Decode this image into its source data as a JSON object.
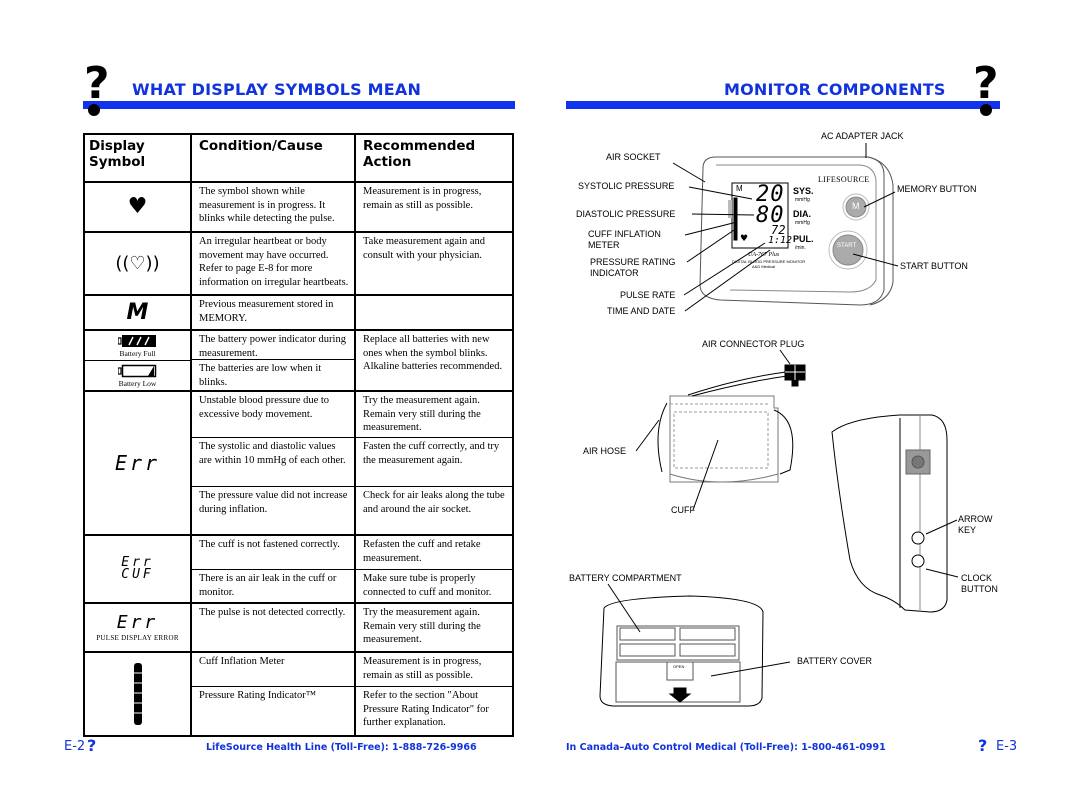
{
  "left_page": {
    "title": "WHAT DISPLAY SYMBOLS MEAN",
    "page_number": "E-2",
    "footer_text": "LifeSource Health Line (Toll-Free): 1-888-726-9966",
    "table": {
      "headers": [
        "Display Symbol",
        "Condition/Cause",
        "Recommended Action"
      ],
      "header_line1": [
        "Display",
        "Condition/Cause",
        "Recommended"
      ],
      "header_line2": [
        "Symbol",
        "",
        "Action"
      ],
      "groups": [
        {
          "symbol_icon": "heart-icon",
          "rows": [
            {
              "condition": "The symbol shown while measurement is in progress. It blinks while detecting the pulse.",
              "action": "Measurement is in progress, remain as still as possible."
            }
          ]
        },
        {
          "symbol_icon": "irregular-heartbeat-icon",
          "rows": [
            {
              "condition": "An irregular heartbeat or body movement may have occurred. Refer to page E-8 for more information on irregular heartbeats.",
              "action": "Take measurement again and consult with your physician."
            }
          ]
        },
        {
          "symbol_text": "M",
          "symbol_icon": "memory-icon",
          "rows": [
            {
              "condition": "Previous measurement stored in MEMORY.",
              "action": ""
            }
          ]
        },
        {
          "symbol_icon": "battery-icon",
          "symbol_labels": [
            "Battery Full",
            "Battery Low"
          ],
          "rows": [
            {
              "condition": "The battery power indicator during measurement.",
              "action": "Replace all batteries with new ones when the symbol blinks. Alkaline batteries recommended."
            },
            {
              "condition": "The batteries are low when it blinks.",
              "action": ""
            }
          ]
        },
        {
          "symbol_text": "Err",
          "rows": [
            {
              "condition": "Unstable blood pressure due to excessive body movement.",
              "action": "Try the measurement again. Remain very still during the measurement."
            },
            {
              "condition": "The systolic and diastolic values are within 10 mmHg of each other.",
              "action": "Fasten the cuff correctly, and try the measurement again."
            },
            {
              "condition": "The pressure value did not increase during inflation.",
              "action": "Check for air leaks along the tube and around the air socket."
            }
          ]
        },
        {
          "symbol_text": "Err",
          "symbol_text2": "CUF",
          "rows": [
            {
              "condition": "The cuff is not fastened correctly.",
              "action": "Refasten the cuff and retake measurement."
            },
            {
              "condition": "There is an air leak in the cuff or monitor.",
              "action": "Make sure tube is properly connected to cuff and monitor."
            }
          ]
        },
        {
          "symbol_text": "Err",
          "symbol_caption": "PULSE DISPLAY ERROR",
          "rows": [
            {
              "condition": "The pulse is not detected correctly.",
              "action": "Try the measurement again. Remain very still during the measurement."
            }
          ]
        },
        {
          "symbol_icon": "bar-meter-icon",
          "rows": [
            {
              "condition": "Cuff Inflation Meter",
              "action": "Measurement is in progress, remain as still as possible."
            },
            {
              "condition": "Pressure Rating Indicator™",
              "action": "Refer to the section \"About Pressure Rating Indicator\" for further explanation."
            }
          ]
        }
      ]
    }
  },
  "right_page": {
    "title": "MONITOR COMPONENTS",
    "page_number": "E-3",
    "footer_text": "In Canada–Auto Control Medical (Toll-Free): 1-800-461-0991",
    "labels": {
      "ac_adapter_jack": "AC ADAPTER JACK",
      "air_socket": "AIR SOCKET",
      "systolic_pressure": "SYSTOLIC PRESSURE",
      "diastolic_pressure": "DIASTOLIC PRESSURE",
      "cuff_inflation_meter_1": "CUFF INFLATION",
      "cuff_inflation_meter_2": "METER",
      "pressure_rating_1": "PRESSURE RATING",
      "pressure_rating_2": "INDICATOR",
      "pulse_rate": "PULSE RATE",
      "time_and_date": "TIME AND DATE",
      "memory_button": "MEMORY BUTTON",
      "start_button": "START BUTTON",
      "air_connector_plug": "AIR CONNECTOR PLUG",
      "air_hose": "AIR HOSE",
      "cuff": "CUFF",
      "arrow_key_1": "ARROW",
      "arrow_key_2": "KEY",
      "clock_button_1": "CLOCK",
      "clock_button_2": "BUTTON",
      "battery_compartment": "BATTERY COMPARTMENT",
      "battery_cover": "BATTERY COVER"
    },
    "display": {
      "systolic": "20",
      "diastolic": "80",
      "pulse": "72",
      "time": "1:12",
      "sys_label": "SYS.",
      "sys_unit": "mmHg",
      "dia_label": "DIA.",
      "dia_unit": "mmHg",
      "pul_label": "PUL.",
      "pul_unit": "/min.",
      "memory_indicator": "M",
      "brand": "LIFESOURCE",
      "model": "UA-767 Plus",
      "subtitle": "DIGITAL BLOOD PRESSURE MONITOR",
      "maker": "A&D Medical",
      "memory_btn": "M",
      "start_btn": "START",
      "open_label": "OPEN"
    }
  },
  "colors": {
    "accent_blue": "#1133ee",
    "title_blue": "#1133dd",
    "button_gray": "#a8a8a8"
  }
}
